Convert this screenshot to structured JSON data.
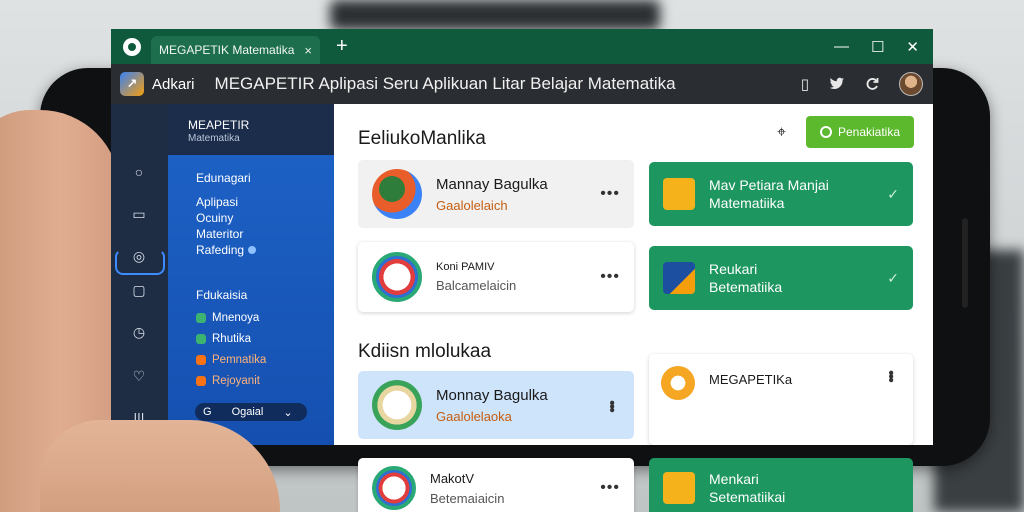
{
  "window": {
    "tab_title": "MEGAPETIK Matematika",
    "tab_close": "×",
    "new_tab": "+",
    "ctrl_minimize": "—",
    "ctrl_maximize": "☐",
    "ctrl_close": "✕"
  },
  "addressbar": {
    "app_name": "Adkari",
    "page_title": "MEGAPETIR Aplipasi Seru Aplikuan Litar Belajar Matematika",
    "icons": [
      "tablet-icon",
      "twitter-icon",
      "refresh-icon",
      "avatar"
    ]
  },
  "sidebar": {
    "header_title": "MEAPETIR",
    "header_sub": "Matematika",
    "group1": [
      "Edunagari",
      "Aplipasi",
      "Ocuiny",
      "Materitor",
      "Rafeding"
    ],
    "group2_title": "Fdukaisia",
    "group2": [
      {
        "label": "Mnenoya",
        "color": "#3cb371"
      },
      {
        "label": "Rhutika",
        "color": "#3cb371"
      },
      {
        "label": "Pemnatika",
        "color": "#f97316"
      },
      {
        "label": "Rejoyanit",
        "color": "#f97316"
      }
    ],
    "select_icon": "G",
    "select_value": "Ogaial",
    "select_caret": "⌄"
  },
  "main": {
    "section1_title": "EeliukoManlika",
    "section2_title": "Kdiisn mlolukaa",
    "primary_button": "Penakiatika",
    "cards": [
      {
        "title": "Mannay Bagulka",
        "sub": "Gaalolelaich"
      },
      {
        "title": "Mav Petiara Manjai",
        "sub": "Matematiika"
      },
      {
        "title": "Koni PAMIV",
        "sub": "Balcamelaicin"
      },
      {
        "title": "Reukari",
        "sub": "Betematiika"
      },
      {
        "title": "Monnay Bagulka",
        "sub": "Gaalolelaoka"
      },
      {
        "title": "MEGAPETIKa",
        "sub": ""
      },
      {
        "title": "MakotV",
        "sub": "Betemaiaicin"
      },
      {
        "title": "Menkari",
        "sub": "Setematiikai"
      }
    ]
  },
  "colors": {
    "titlebar": "#0f5a3c",
    "sidebar": "#1e63c8",
    "green_card": "#1e9660",
    "primary": "#5cb82c"
  }
}
